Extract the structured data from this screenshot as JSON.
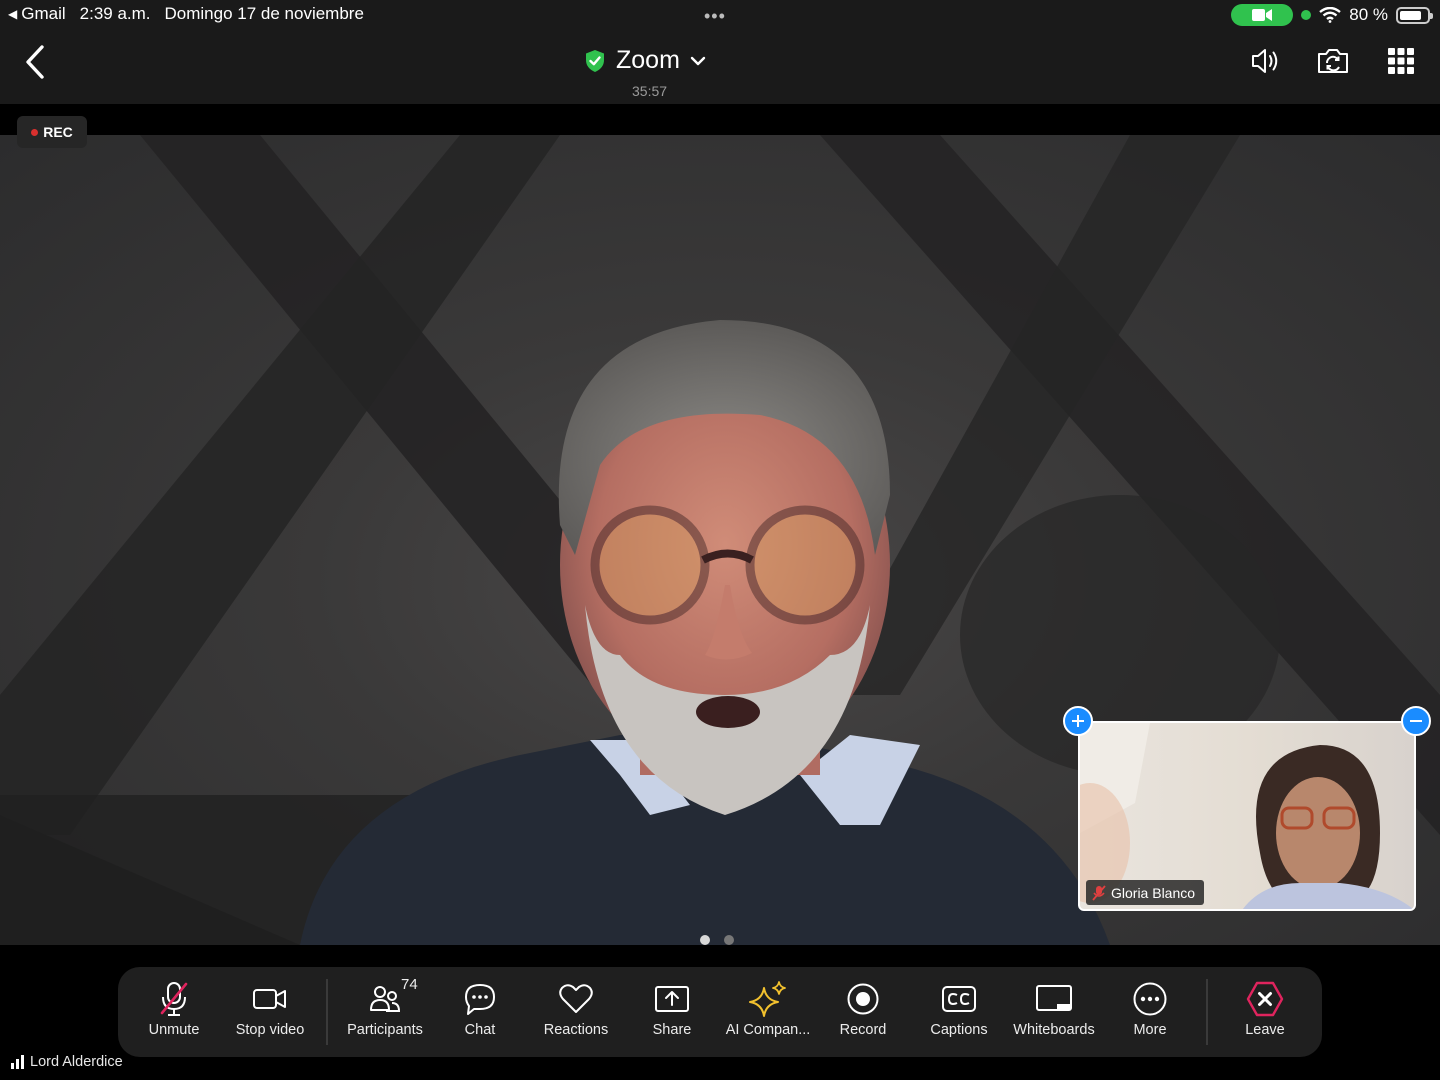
{
  "status_bar": {
    "back_app": "Gmail",
    "time": "2:39 a.m.",
    "date": "Domingo 17 de noviembre",
    "multitask_dots": "•••",
    "battery": "80 %",
    "battery_level": 0.8
  },
  "header": {
    "title": "Zoom",
    "duration": "35:57"
  },
  "recording": {
    "badge": "REC"
  },
  "self_view": {
    "name": "Gloria Blanco"
  },
  "toolbar": {
    "unmute": "Unmute",
    "stop_video": "Stop video",
    "participants": "Participants",
    "participants_count": "74",
    "chat": "Chat",
    "reactions": "Reactions",
    "share": "Share",
    "ai_companion": "AI Compan...",
    "record": "Record",
    "captions": "Captions",
    "whiteboards": "Whiteboards",
    "more": "More",
    "leave": "Leave"
  },
  "active_speaker": {
    "name": "Lord Alderdice"
  },
  "colors": {
    "shield_green": "#30c24e",
    "leave_red": "#e0245e",
    "ai_yellow": "#f2c12e",
    "self_view_button": "#1a8cff"
  },
  "icons": {
    "back": "chevron-left-icon",
    "shield": "shield-check-icon",
    "speaker": "speaker-icon",
    "camera_flip": "camera-flip-icon",
    "grid": "grid-icon"
  }
}
